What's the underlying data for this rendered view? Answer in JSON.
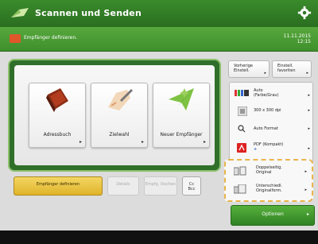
{
  "titlebar": {
    "title": "Scannen und Senden"
  },
  "statusbar": {
    "message": "Empfänger definieren.",
    "date": "11.11.2015",
    "time": "12:15"
  },
  "destinations": [
    {
      "label": "Adressbuch"
    },
    {
      "label": "Zielwahl"
    },
    {
      "label": "Neuer Empfänger"
    }
  ],
  "bottom_buttons": {
    "empfaenger": "Empfänger definieren",
    "details": "Details",
    "empf_loeschen": "Empfg. löschen",
    "cc": "Cc",
    "bcc": "Bcc"
  },
  "top_buttons": {
    "vorherige": [
      "Vorherige",
      "Einstell."
    ],
    "einstell_favoriten": [
      "Einstell.",
      "favoriten"
    ]
  },
  "settings": [
    {
      "icon": "color-mode-icon",
      "line1": "Auto",
      "line2": "(Farbe/Grau)"
    },
    {
      "icon": "resolution-icon",
      "line1": "300 x 300 dpi",
      "line2": ""
    },
    {
      "icon": "auto-format-icon",
      "line1": "Auto Format",
      "line2": ""
    },
    {
      "icon": "pdf-icon",
      "line1": "PDF (Kompakt)",
      "line2": "+"
    }
  ],
  "originals": [
    {
      "line1": "Doppelseitig.",
      "line2": "Original"
    },
    {
      "line1": "Unterschiedl.",
      "line2": "Originalform."
    }
  ],
  "options_label": "Optionen",
  "colors": {
    "brand_green": "#3a8b2c",
    "accent_yellow": "#e0b42a",
    "highlight_orange": "#e9b44a"
  }
}
